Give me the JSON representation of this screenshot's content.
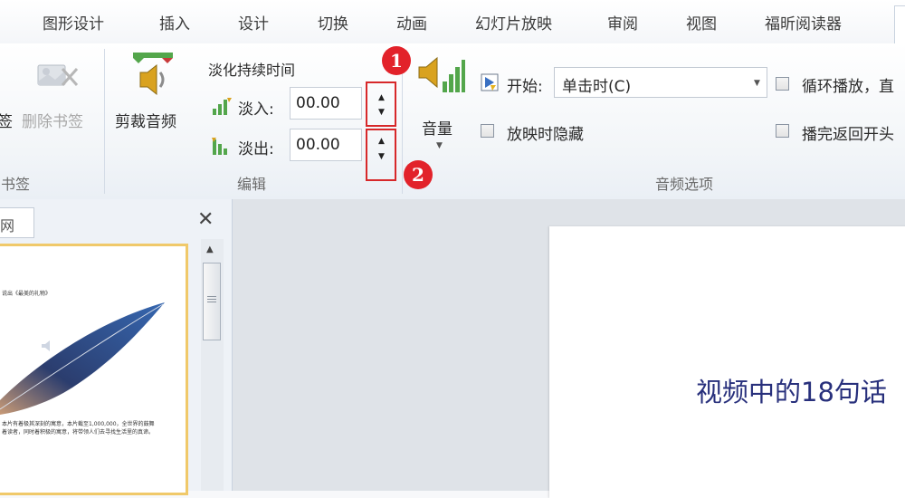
{
  "tabs": [
    {
      "label": "图形设计"
    },
    {
      "label": "插入"
    },
    {
      "label": "设计"
    },
    {
      "label": "切换"
    },
    {
      "label": "动画"
    },
    {
      "label": "幻灯片放映"
    },
    {
      "label": "审阅"
    },
    {
      "label": "视图"
    },
    {
      "label": "福昕阅读器"
    }
  ],
  "ribbon": {
    "bookmarks": {
      "add_label_partial": "签",
      "remove_label": "删除书签",
      "group_label": "书签"
    },
    "editing": {
      "trim_label": "剪裁音频",
      "fade_duration_title": "淡化持续时间",
      "fade_in_label": "淡入:",
      "fade_in_value": "00.00",
      "fade_out_label": "淡出:",
      "fade_out_value": "00.00",
      "group_label": "编辑"
    },
    "audio_options": {
      "volume_label": "音量",
      "start_label": "开始:",
      "start_value": "单击时(C)",
      "hide_label": "放映时隐藏",
      "loop_label": "循环播放，直",
      "rewind_label": "播完返回开头",
      "group_label": "音频选项"
    }
  },
  "annotations": {
    "badge1": "1",
    "badge2": "2"
  },
  "left_pane": {
    "tab_label": "网"
  },
  "slide": {
    "title": "视频中的18句话",
    "thumb_text_top": "说出《最美的礼物》",
    "thumb_text_bottom": "本片有着极其深刻的寓意，本片截至1,000,000，全世界的鼓舞着读者，同时着积极的寓意，将带领人们去寻找生活里的真谛。"
  },
  "colors": {
    "accent_red": "#e2222a",
    "slide_title": "#28307c",
    "thumb_border": "#f0c96a"
  }
}
